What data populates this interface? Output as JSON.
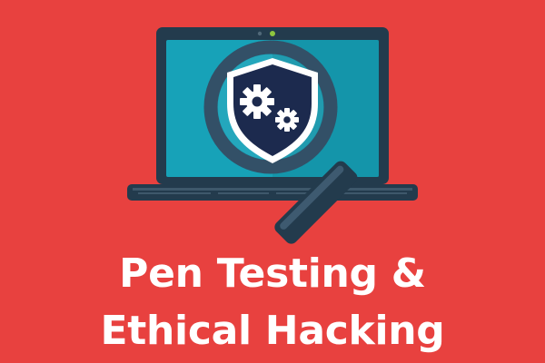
{
  "headline": {
    "line_1": "Pen Testing &",
    "line_2": "Ethical Hacking"
  },
  "icons": {
    "device": "laptop-icon",
    "tool": "magnifying-glass-icon",
    "badge": "security-shield-icon",
    "symbol": "gears-icon"
  },
  "colors": {
    "background": "#E8413F",
    "text": "#FFFFFF",
    "laptop_frame": "#233B4D",
    "screen": "#17A2B8",
    "magnifier_ring": "#335067",
    "shield_fill": "#1C2A4E",
    "gear_fill": "#FFFFFF",
    "camera_led": "#8DC63F"
  }
}
